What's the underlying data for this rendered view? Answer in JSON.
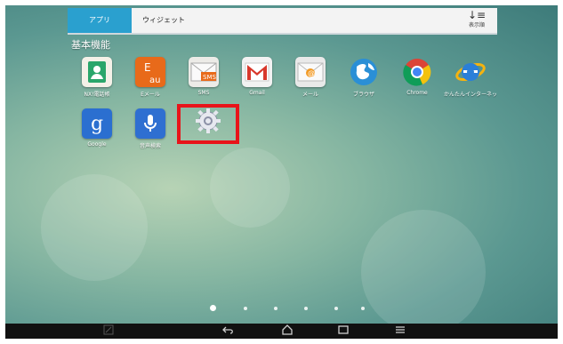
{
  "tabs": [
    {
      "label": "アプリ",
      "active": true
    },
    {
      "label": "ウィジェット",
      "active": false
    }
  ],
  "sort": {
    "icon": "sort-icon",
    "label": "表示順"
  },
  "section_title": "基本機能",
  "apps": [
    {
      "label": "NX!電話帳",
      "icon": "contacts-icon",
      "color": "#f4f1e8"
    },
    {
      "label": "Eメール",
      "icon": "au-email-icon",
      "color": "#e86a1a"
    },
    {
      "label": "SMS",
      "icon": "sms-icon",
      "color": "#ecebe7"
    },
    {
      "label": "Gmail",
      "icon": "gmail-icon",
      "color": "#f2f2f2"
    },
    {
      "label": "メール",
      "icon": "email-icon",
      "color": "#e9e9e9"
    },
    {
      "label": "ブラウザ",
      "icon": "browser-globe-icon",
      "color": "#2a8fd6"
    },
    {
      "label": "Chrome",
      "icon": "chrome-icon",
      "color": "#ffffff"
    },
    {
      "label": "かんたんインターネット",
      "icon": "ie-browser-icon",
      "color": "#2b7fd8"
    },
    {
      "label": "Google",
      "icon": "google-search-icon",
      "color": "#2b6fd0"
    },
    {
      "label": "音声検索",
      "icon": "voice-search-icon",
      "color": "#2f6fd1"
    },
    {
      "label": "",
      "icon": "settings-gear-icon",
      "color": "#ffffff"
    }
  ],
  "page_indicator": {
    "count": 6,
    "active": 0
  },
  "navbar": {
    "buttons": [
      {
        "name": "pen-icon"
      },
      {
        "name": "back-icon"
      },
      {
        "name": "home-icon"
      },
      {
        "name": "recent-apps-icon"
      },
      {
        "name": "menu-icon"
      }
    ]
  },
  "colors": {
    "tab_active": "#2aa0cf",
    "highlight": "#e8141a"
  }
}
